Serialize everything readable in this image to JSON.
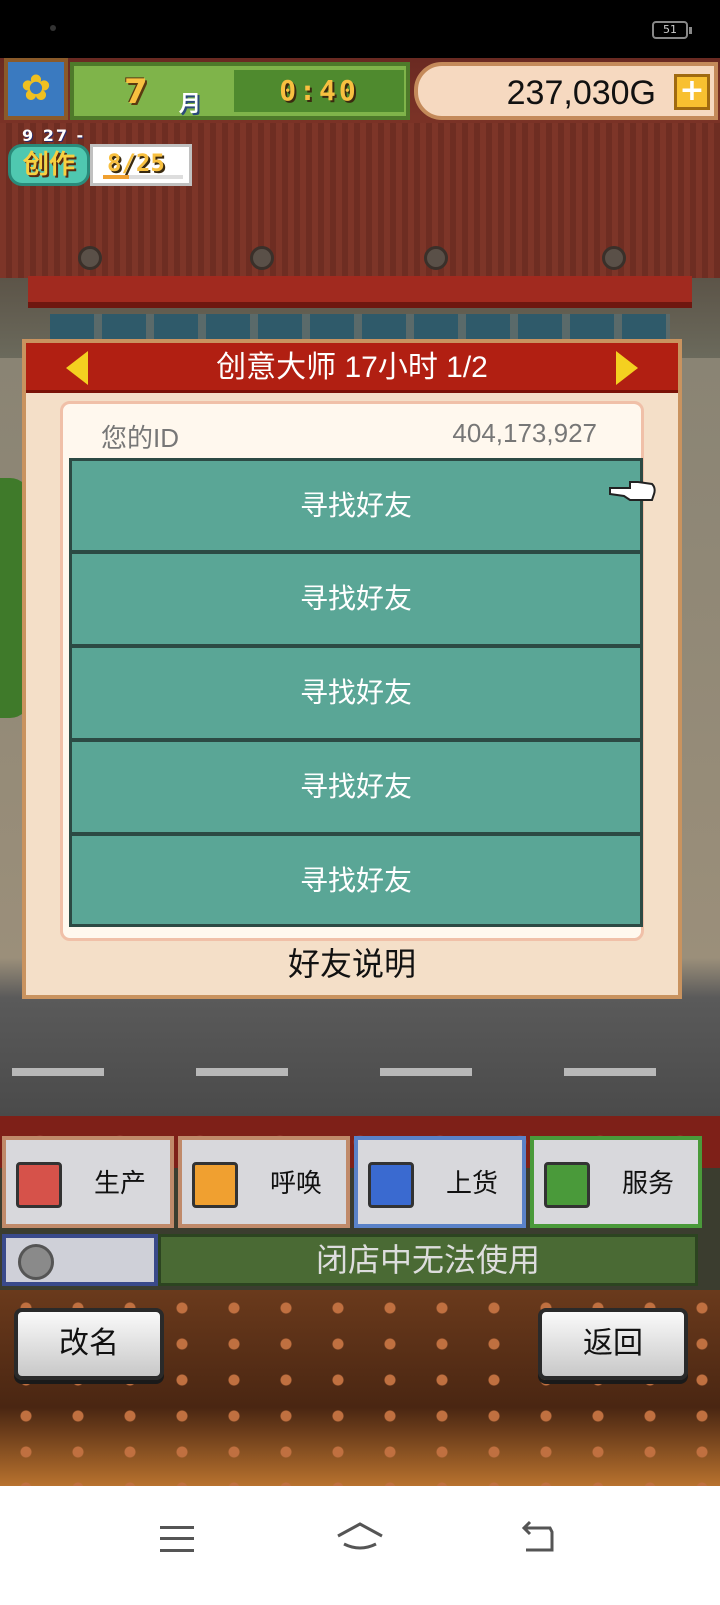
{
  "status_bar": {
    "battery": "51"
  },
  "hud": {
    "flower_icon": "sunflower-icon",
    "month_number": "7",
    "month_unit": "月",
    "time": "0:40",
    "money": "237,030",
    "money_unit": "G",
    "money_add": "+"
  },
  "create_badge": {
    "date_small": "9 27 -",
    "label": "创作",
    "count": "8/25",
    "progress": 0.32
  },
  "dialog": {
    "title": "创意大师  17小时 1/2",
    "id_label": "您的ID",
    "id_value": "404,173,927",
    "friend_slots": [
      "寻找好友",
      "寻找好友",
      "寻找好友",
      "寻找好友",
      "寻找好友"
    ],
    "help_label": "好友说明"
  },
  "actions": [
    {
      "label": "生产",
      "icon": "bread-icon",
      "color": "#d6524a"
    },
    {
      "label": "呼唤",
      "icon": "flag-icon",
      "color": "#f0a030"
    },
    {
      "label": "上货",
      "icon": "cake-icon",
      "color": "#3a6ad0"
    },
    {
      "label": "服务",
      "icon": "coffee-cup-icon",
      "color": "#4a9a3a"
    }
  ],
  "status": {
    "closed_text": "闭店中无法使用"
  },
  "panel_buttons": {
    "rename": "改名",
    "back": "返回"
  },
  "colors": {
    "dialog_header": "#b11f12",
    "friend_slot": "#5aa696",
    "money_bar": "#f6d9c0"
  }
}
